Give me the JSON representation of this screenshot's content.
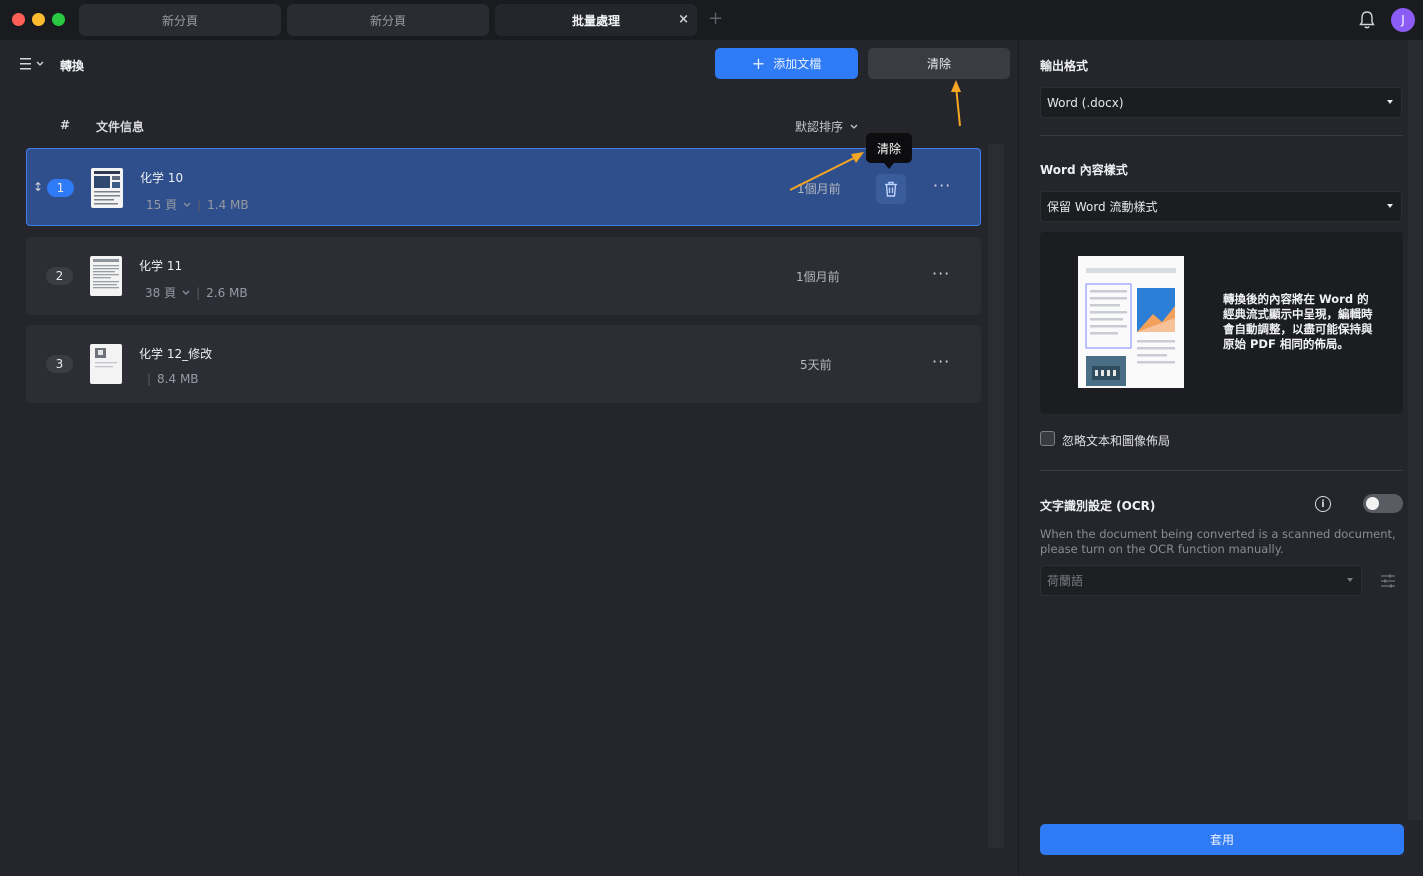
{
  "tabs": [
    {
      "label": "新分頁"
    },
    {
      "label": "新分頁"
    },
    {
      "label": "批量處理",
      "close": "×"
    }
  ],
  "tab_add": "+",
  "user": {
    "avatar_initial": "J"
  },
  "left": {
    "title": "轉換",
    "add_button": "添加文檔",
    "add_icon": "+",
    "clear_button": "清除",
    "columns": {
      "hash": "#",
      "info": "文件信息",
      "sort": "默認排序"
    },
    "tooltip": "清除",
    "files": [
      {
        "index": "1",
        "name": "化学 10",
        "pages": "15 頁",
        "size": "1.4 MB",
        "time": "1個月前",
        "selected": true
      },
      {
        "index": "2",
        "name": "化学 11",
        "pages": "38 頁",
        "size": "2.6 MB",
        "time": "1個月前",
        "selected": false
      },
      {
        "index": "3",
        "name": "化学 12_修改",
        "pages": "",
        "size": "8.4 MB",
        "time": "5天前",
        "selected": false
      }
    ],
    "more_label": "···"
  },
  "right": {
    "output_format_label": "輸出格式",
    "output_format_value": "Word (.docx)",
    "word_style_label": "Word 內容樣式",
    "word_style_value": "保留 Word 流動樣式",
    "preview_text": "轉換後的內容將在 Word 的經典流式顯示中呈現，編輯時會自動調整，以盡可能保持與原始 PDF 相同的佈局。",
    "ignore_layout_label": "忽略文本和圖像佈局",
    "ocr_label": "文字識別設定 (OCR)",
    "ocr_description": "When the document being converted is a scanned document, please turn on the OCR function manually.",
    "ocr_language": "荷蘭語",
    "apply_button": "套用"
  },
  "colors": {
    "accent": "#2f7bf5",
    "annotation_arrow": "#f5a623"
  }
}
